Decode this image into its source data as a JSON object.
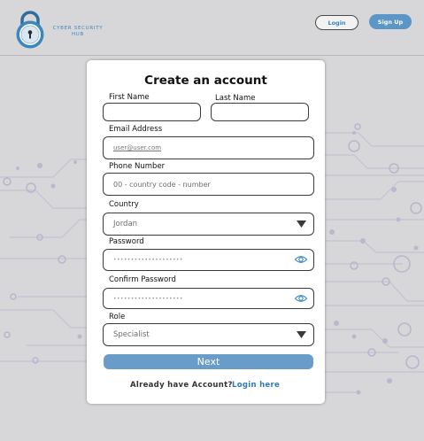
{
  "header": {
    "brand_text": "CYBER SECURITY HUB",
    "login_label": "Login",
    "signup_label": "Sign Up",
    "logo_icon": "padlock-logo-icon"
  },
  "form": {
    "title": "Create an account",
    "first_name_label": "First Name",
    "first_name_value": "",
    "last_name_label": "Last Name",
    "last_name_value": "",
    "email_label": "Email Address",
    "email_placeholder": "user@user.com",
    "phone_label": "Phone Number",
    "phone_placeholder": "00 - country code - number",
    "country_label": "Country",
    "country_value": "Jordan",
    "password_label": "Password",
    "password_value": "••••••••••••••••••••",
    "confirm_label": "Confirm Password",
    "confirm_value": "••••••••••••••••••••",
    "role_label": "Role",
    "role_value": "Specialist",
    "next_label": "Next",
    "already_text": "Already have Account?",
    "login_link": "Login here"
  },
  "colors": {
    "accent": "#5b96c6",
    "link": "#2e7bb5",
    "background": "#d7d7d9"
  }
}
